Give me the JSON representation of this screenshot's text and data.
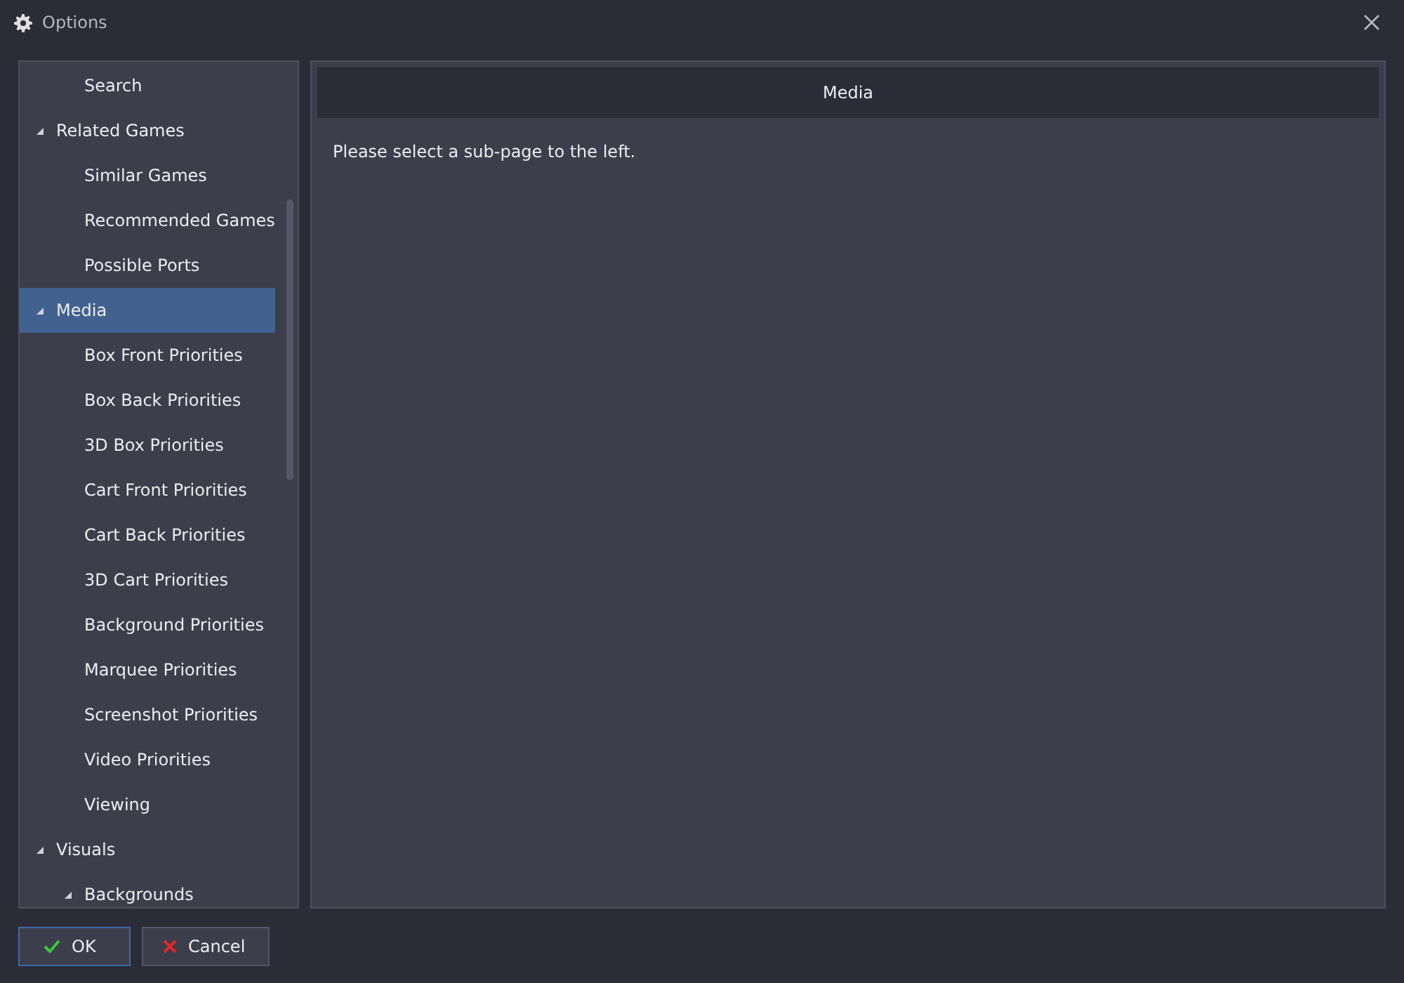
{
  "window": {
    "title": "Options"
  },
  "tree": {
    "leading_items": [
      {
        "label": "Search",
        "selected": false
      }
    ],
    "items": [
      {
        "label": "Related Games",
        "selected": false,
        "expanded": true,
        "children": [
          {
            "label": "Similar Games",
            "selected": false
          },
          {
            "label": "Recommended Games",
            "selected": false
          },
          {
            "label": "Possible Ports",
            "selected": false
          }
        ]
      },
      {
        "label": "Media",
        "selected": true,
        "expanded": true,
        "children": [
          {
            "label": "Box Front Priorities",
            "selected": false
          },
          {
            "label": "Box Back Priorities",
            "selected": false
          },
          {
            "label": "3D Box Priorities",
            "selected": false
          },
          {
            "label": "Cart Front Priorities",
            "selected": false
          },
          {
            "label": "Cart Back Priorities",
            "selected": false
          },
          {
            "label": "3D Cart Priorities",
            "selected": false
          },
          {
            "label": "Background Priorities",
            "selected": false
          },
          {
            "label": "Marquee Priorities",
            "selected": false
          },
          {
            "label": "Screenshot Priorities",
            "selected": false
          },
          {
            "label": "Video Priorities",
            "selected": false
          },
          {
            "label": "Viewing",
            "selected": false
          }
        ]
      },
      {
        "label": "Visuals",
        "selected": false,
        "expanded": true,
        "children": [
          {
            "label": "Backgrounds",
            "selected": false,
            "expanded": true
          }
        ]
      }
    ]
  },
  "page": {
    "title": "Media",
    "message": "Please select a sub-page to the left."
  },
  "buttons": [
    {
      "kind": "ok",
      "label": "OK",
      "focused": true
    },
    {
      "kind": "cancel",
      "label": "Cancel",
      "focused": false
    }
  ]
}
